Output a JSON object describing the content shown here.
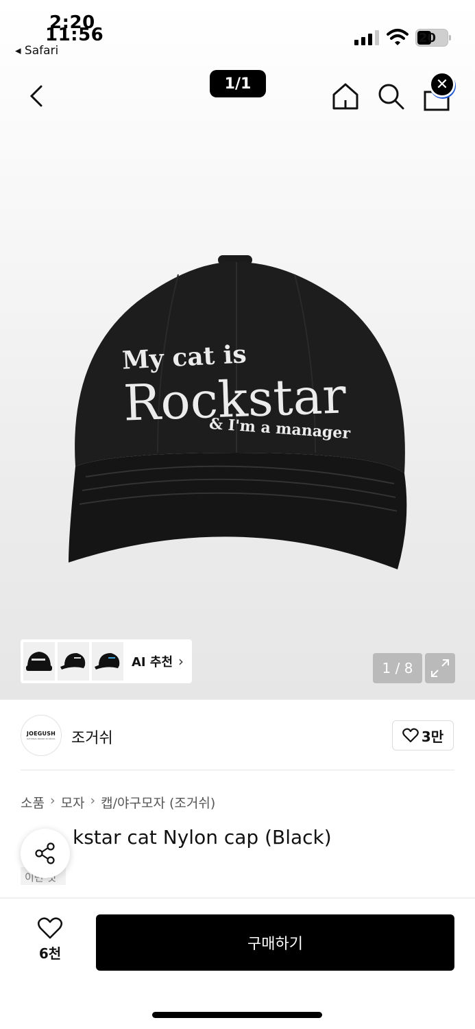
{
  "status_bar": {
    "time_primary": "2:20",
    "time_overlay": "11:56",
    "back_app": "◂ Safari",
    "battery_level": "20",
    "signal_bars": 3
  },
  "nav": {
    "page_indicator": "1/1",
    "close_glyph": "✕",
    "icons": [
      "chevron-left-icon",
      "home-icon",
      "search-icon",
      "shopping-bag-icon"
    ]
  },
  "product_image": {
    "cap_line1": "My cat is",
    "cap_line2": "Rockstar",
    "cap_line3": "& I'm a manager",
    "ai_label": "AI 추천",
    "ai_chevron": "›",
    "image_counter": "1 / 8"
  },
  "brand": {
    "logo_text": "JOEGUSH",
    "logo_subtext": "RATIONAL BRAND IN SEOUL",
    "name": "조거쉬",
    "likes": "3만"
  },
  "breadcrumb": {
    "items": [
      "소품",
      "모자",
      "캡/야구모자 (조거쉬)"
    ],
    "separator": "›"
  },
  "product": {
    "title_visible": "kstar cat Nylon cap (Black)",
    "tag_partial": "이번 깃"
  },
  "bottom_bar": {
    "wishlist_count": "6천",
    "buy_label": "구매하기"
  },
  "colors": {
    "accent": "#000000",
    "battery_bg": "#cfcfcf",
    "badge_ring": "#1f57d4"
  }
}
